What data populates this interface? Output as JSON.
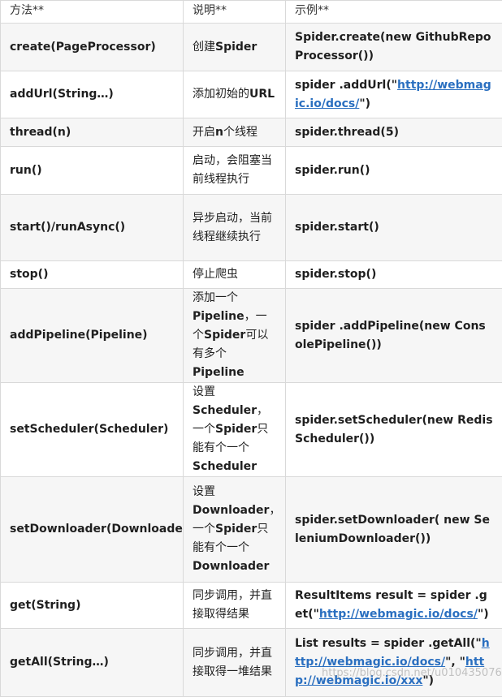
{
  "headers": {
    "method": "方法**",
    "desc": "说明**",
    "example": "示例**"
  },
  "rows": [
    {
      "method": "create(PageProcessor)",
      "desc": [
        "创建",
        {
          "b": "Spider"
        }
      ],
      "example": [
        "Spider.create(new GithubRepoProcessor())"
      ]
    },
    {
      "method": "addUrl(String…)",
      "desc": [
        "添加初始的",
        {
          "b": "URL"
        }
      ],
      "example": [
        "spider .addUrl(\"",
        {
          "link": "http://webmagic.io/docs/"
        },
        "\")"
      ]
    },
    {
      "method": "thread(n)",
      "desc": [
        "开启",
        {
          "b": "n"
        },
        "个线程"
      ],
      "example": [
        "spider.thread(5)"
      ]
    },
    {
      "method": "run()",
      "desc": [
        "启动，会阻塞当前线程执行"
      ],
      "example": [
        "spider.run()"
      ]
    },
    {
      "method": "start()/runAsync()",
      "desc": [
        "异步启动，当前线程继续执行"
      ],
      "example": [
        "spider.start()"
      ]
    },
    {
      "method": "stop()",
      "desc": [
        "停止爬虫"
      ],
      "example": [
        "spider.stop()"
      ]
    },
    {
      "method": "addPipeline(Pipeline)",
      "desc": [
        "添加一个",
        {
          "b": "Pipeline"
        },
        "，一个",
        {
          "b": "Spider"
        },
        "可以有多个",
        {
          "b": "Pipeline"
        }
      ],
      "example": [
        "spider .addPipeline(new ConsolePipeline())"
      ]
    },
    {
      "method": "setScheduler(Scheduler)",
      "desc": [
        "设置",
        {
          "b": "Scheduler"
        },
        "，一个",
        {
          "b": "Spider"
        },
        "只能有个一个",
        {
          "b": "Scheduler"
        }
      ],
      "example": [
        "spider.setScheduler(new RedisScheduler())"
      ]
    },
    {
      "method": "setDownloader(Downloader)",
      "desc": [
        "设置",
        {
          "b": "Downloader"
        },
        "，一个",
        {
          "b": "Spider"
        },
        "只能有个一个",
        {
          "b": "Downloader"
        }
      ],
      "example": [
        "spider.setDownloader( new SeleniumDownloader())"
      ]
    },
    {
      "method": "get(String)",
      "desc": [
        "同步调用，并直接取得结果"
      ],
      "example": [
        "ResultItems result = spider .get(\"",
        {
          "link": "http://webmagic.io/docs/"
        },
        "\")"
      ]
    },
    {
      "method": "getAll(String…)",
      "desc": [
        "同步调用，并直接取得一堆结果"
      ],
      "example": [
        "List results = spider .getAll(\"",
        {
          "link": "http://webmagic.io/docs/"
        },
        "\", \"",
        {
          "link": "http://webmagic.io/xxx"
        },
        "\")"
      ]
    }
  ],
  "row_heights": [],
  "watermark": "https://blog.csdn.net/u010435076",
  "colors": {
    "link": "#2a6fc0",
    "border": "#d9d9d9",
    "row_alt": "#f6f6f6"
  }
}
